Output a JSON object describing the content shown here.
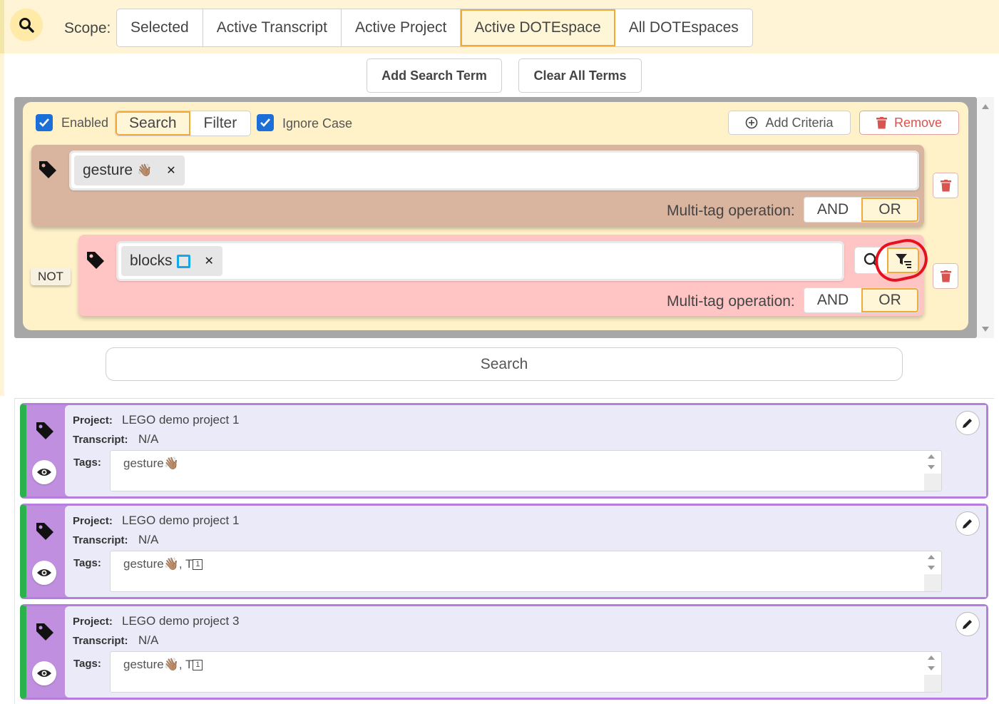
{
  "scope": {
    "label": "Scope:",
    "options": [
      "Selected",
      "Active Transcript",
      "Active Project",
      "Active DOTEspace",
      "All DOTEspaces"
    ],
    "active": "Active DOTEspace"
  },
  "toolbar": {
    "add_term": "Add Search Term",
    "clear_terms": "Clear All Terms"
  },
  "criteria": {
    "enabled_label": "Enabled",
    "mode_search": "Search",
    "mode_filter": "Filter",
    "mode_active": "Search",
    "ignore_case_label": "Ignore Case",
    "add_criteria": "Add Criteria",
    "remove": "Remove",
    "terms": [
      {
        "tag": "gesture",
        "tag_emoji": "👋🏽",
        "multi_label": "Multi-tag operation:",
        "and": "AND",
        "or": "OR",
        "selected": "OR"
      },
      {
        "negated_label": "NOT",
        "tag": "blocks",
        "multi_label": "Multi-tag operation:",
        "and": "AND",
        "or": "OR",
        "selected": "OR"
      }
    ]
  },
  "search_button": "Search",
  "results": [
    {
      "project_label": "Project:",
      "project": "LEGO demo project 1",
      "transcript_label": "Transcript:",
      "transcript": "N/A",
      "tags_label": "Tags:",
      "tags": "gesture",
      "tags_emoji": "👋🏽",
      "tags_suffix": ""
    },
    {
      "project_label": "Project:",
      "project": "LEGO demo project 1",
      "transcript_label": "Transcript:",
      "transcript": "N/A",
      "tags_label": "Tags:",
      "tags": "gesture",
      "tags_emoji": "👋🏽",
      "tags_suffix": ", T",
      "tags_box": "1"
    },
    {
      "project_label": "Project:",
      "project": "LEGO demo project 3",
      "transcript_label": "Transcript:",
      "transcript": "N/A",
      "tags_label": "Tags:",
      "tags": "gesture",
      "tags_emoji": "👋🏽",
      "tags_suffix": ", T",
      "tags_box": "1"
    }
  ],
  "colors": {
    "accent_orange": "#f2a93b",
    "checkbox_blue": "#1d6fd8",
    "remove_red": "#d9534f",
    "annotation_red": "#e3121e",
    "result_border_purple": "#b57edc",
    "result_stripe_green": "#2bb24c"
  }
}
